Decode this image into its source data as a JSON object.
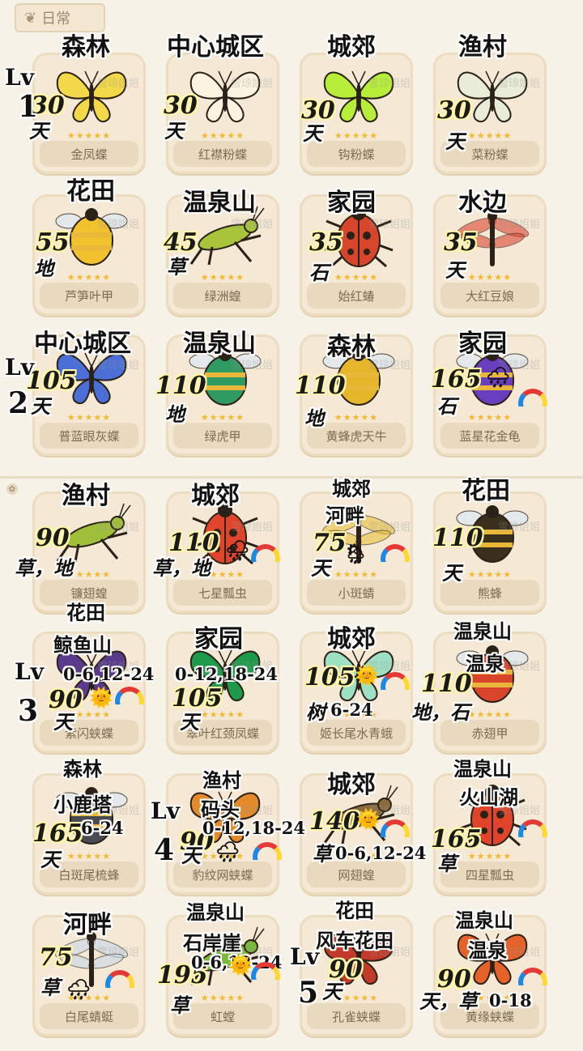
{
  "section_title": "日常",
  "watermark": "雪琼姐姐",
  "levels": [
    {
      "label": "Lv",
      "number": "1"
    },
    {
      "label": "Lv",
      "number": "2"
    },
    {
      "label": "Lv",
      "number": "3"
    },
    {
      "label": "Lv",
      "number": "4"
    },
    {
      "label": "Lv",
      "number": "5"
    }
  ],
  "cards": [
    {
      "name": "金凤蝶",
      "stars": "★★★★★",
      "location": "森林",
      "number": "30",
      "habitat": "天",
      "icon": "swallowtail-butterfly-icon",
      "color": "#f3d94a"
    },
    {
      "name": "红襟粉蝶",
      "stars": "★★★★★",
      "location": "中心城区",
      "number": "30",
      "habitat": "天",
      "icon": "orange-tip-butterfly-icon",
      "color": "#fbf3e0"
    },
    {
      "name": "钩粉蝶",
      "stars": "★★★★★",
      "location": "城郊",
      "number": "30",
      "habitat": "天",
      "icon": "brimstone-butterfly-icon",
      "color": "#b7ee3a"
    },
    {
      "name": "菜粉蝶",
      "stars": "★★★★★",
      "location": "渔村",
      "number": "30",
      "habitat": "天",
      "icon": "cabbage-white-butterfly-icon",
      "color": "#e9ecd8"
    },
    {
      "name": "芦笋叶甲",
      "stars": "★★★★★",
      "location": "花田",
      "number": "55",
      "habitat": "地",
      "icon": "asparagus-beetle-icon",
      "color": "#f2c12e"
    },
    {
      "name": "绿洲蝗",
      "stars": "★★★★★",
      "location": "温泉山",
      "number": "45",
      "habitat": "草",
      "icon": "grasshopper-icon",
      "color": "#a8c43a"
    },
    {
      "name": "始红蝽",
      "stars": "★★★★★",
      "location": "家园",
      "number": "35",
      "habitat": "石",
      "icon": "firebug-icon",
      "color": "#d7452c"
    },
    {
      "name": "大红豆娘",
      "stars": "★★★★★",
      "location": "水边",
      "number": "35",
      "habitat": "天",
      "icon": "damselfly-icon",
      "color": "#d9462f"
    },
    {
      "name": "普蓝眼灰蝶",
      "stars": "★★★★★",
      "location": "中心城区",
      "number": "105",
      "habitat": "天",
      "icon": "blue-butterfly-icon",
      "color": "#4b6fd6"
    },
    {
      "name": "绿虎甲",
      "stars": "★★★★★",
      "location": "温泉山",
      "number": "110",
      "habitat": "地",
      "icon": "tiger-beetle-icon",
      "color": "#2f9a62"
    },
    {
      "name": "黄蜂虎天牛",
      "stars": "★★★★★",
      "location": "森林",
      "number": "110",
      "habitat": "地",
      "icon": "longhorn-beetle-icon",
      "color": "#e5b62a"
    },
    {
      "name": "蓝星花金龟",
      "stars": "★★★★★",
      "location": "家园",
      "number": "165",
      "habitat": "石",
      "icon": "chafer-beetle-icon",
      "color": "#6a3fbf"
    },
    {
      "name": "镰翅蝗",
      "stars": "★★★★★",
      "location": "渔村",
      "number": "90",
      "habitat": "草，地",
      "icon": "sickle-grasshopper-icon",
      "color": "#9fbf3a"
    },
    {
      "name": "七星瓢虫",
      "stars": "★★★★★",
      "location": "城郊",
      "number": "110",
      "habitat": "草，地",
      "icon": "ladybug-icon",
      "color": "#e0452c"
    },
    {
      "name": "小斑蜻",
      "stars": "★★★★★",
      "location": "城郊",
      "location2": "河畔",
      "number": "75",
      "habitat": "天",
      "icon": "dragonfly-icon",
      "color": "#e8c13a"
    },
    {
      "name": "熊蜂",
      "stars": "★★★★★",
      "location": "花田",
      "number": "110",
      "habitat": "天",
      "icon": "bumblebee-icon",
      "color": "#3a2e1c"
    },
    {
      "name": "紫闪蛱蝶",
      "stars": "★★★★★",
      "location": "花田",
      "location2": "鲸鱼山",
      "number": "90",
      "habitat": "天",
      "time": "0-6,12-24",
      "icon": "purple-emperor-icon",
      "color": "#5a3a8a"
    },
    {
      "name": "翠叶红颈凤蝶",
      "stars": "★★★★★",
      "location": "家园",
      "number": "105",
      "habitat": "天",
      "time": "0-12,18-24",
      "icon": "birdwing-butterfly-icon",
      "color": "#1f9a4a"
    },
    {
      "name": "姬长尾水青蛾",
      "stars": "★★★★★",
      "location": "城郊",
      "number": "105",
      "habitat": "树",
      "time": "6-24",
      "icon": "luna-moth-icon",
      "color": "#9ee0c3"
    },
    {
      "name": "赤翅甲",
      "stars": "★★★★★",
      "location": "温泉山",
      "location2": "温泉",
      "number": "110",
      "habitat": "地，石",
      "icon": "red-winged-beetle-icon",
      "color": "#d9452c"
    },
    {
      "name": "白斑尾梳蜂",
      "stars": "★★★★★",
      "location": "森林",
      "location2": "小鹿塔",
      "number": "165",
      "habitat": "天",
      "time": "6-24",
      "icon": "comb-bee-icon",
      "color": "#4a4a52"
    },
    {
      "name": "豹纹网蛱蝶",
      "stars": "★★★★★",
      "location": "渔村",
      "location2": "码头",
      "number": "90",
      "habitat": "天",
      "time": "0-12,18-24",
      "icon": "fritillary-butterfly-icon",
      "color": "#e58a2a"
    },
    {
      "name": "网翅蝗",
      "stars": "★★★★★",
      "location": "城郊",
      "number": "140",
      "habitat": "草",
      "time": "0-6,12-24",
      "icon": "net-winged-grasshopper-icon",
      "color": "#8a6a3a"
    },
    {
      "name": "四星瓢虫",
      "stars": "★★★★★",
      "location": "温泉山",
      "location2": "火山湖",
      "number": "165",
      "habitat": "草",
      "icon": "four-spot-ladybug-icon",
      "color": "#e0452c"
    },
    {
      "name": "白尾蜻蜓",
      "stars": "★★★★★",
      "location": "河畔",
      "number": "75",
      "habitat": "草",
      "icon": "white-tail-dragonfly-icon",
      "color": "#c9d8e8"
    },
    {
      "name": "虹螳",
      "stars": "★★★★★",
      "location": "温泉山",
      "location2": "石岸崖",
      "number": "195",
      "habitat": "草",
      "time": "0-6,12-24",
      "icon": "mantis-icon",
      "color": "#7ab83a"
    },
    {
      "name": "孔雀蛱蝶",
      "stars": "★★★★★",
      "location": "花田",
      "location2": "风车花田",
      "number": "90",
      "habitat": "天",
      "icon": "peacock-butterfly-icon",
      "color": "#c23a2a"
    },
    {
      "name": "黄缘蛱蝶",
      "stars": "★★★★★",
      "location": "温泉山",
      "location2": "温泉",
      "number": "90",
      "habitat": "天，草",
      "time": "0-18",
      "icon": "camberwell-beauty-icon",
      "color": "#e5632a"
    }
  ],
  "weather": {
    "sun": "🌞",
    "rain": "🌧",
    "rain_sun": "🌦"
  }
}
